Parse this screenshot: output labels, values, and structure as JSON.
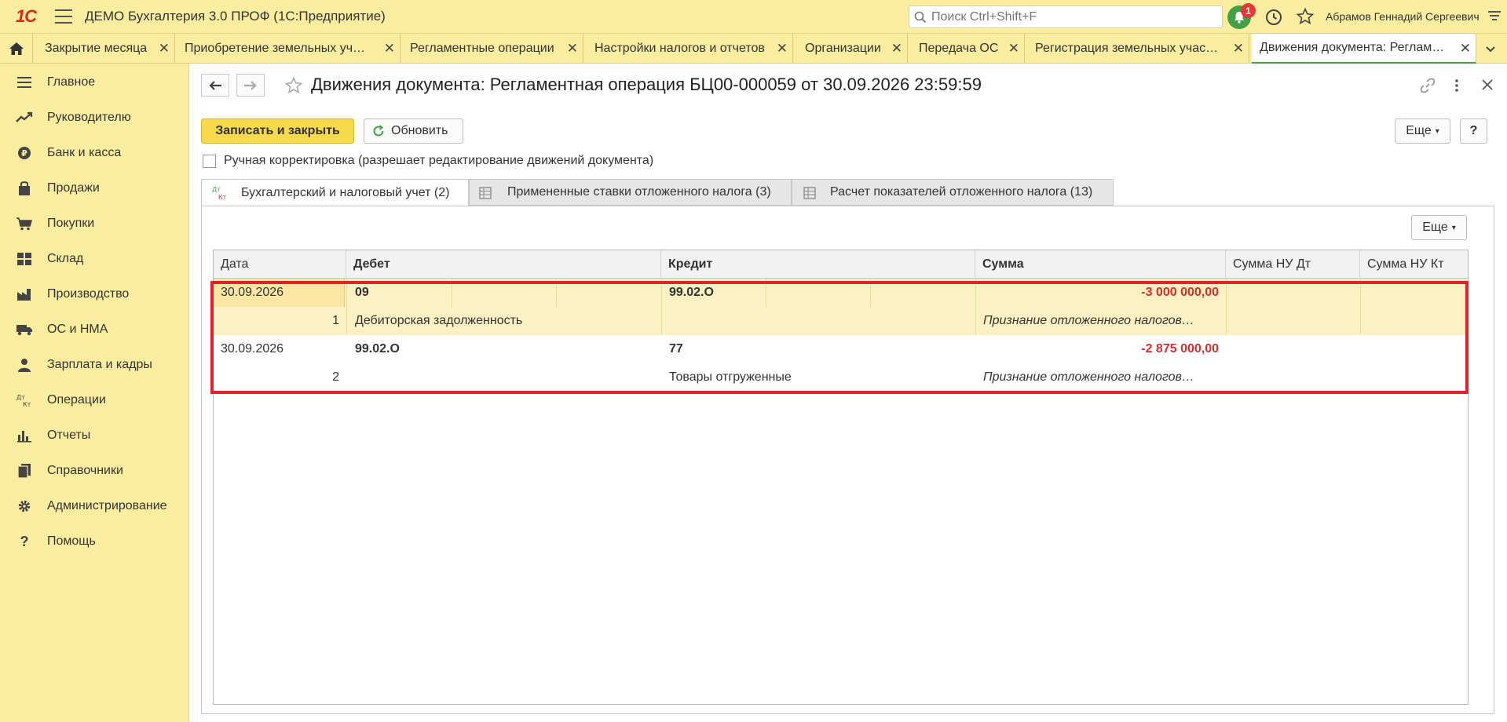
{
  "app": {
    "logo": "1С",
    "title": "ДЕМО Бухгалтерия 3.0 ПРОФ  (1С:Предприятие)",
    "search_placeholder": "Поиск Ctrl+Shift+F",
    "notifications_count": "1",
    "user": "Абрамов Геннадий Сергеевич"
  },
  "tabs": [
    {
      "label": "Закрытие месяца"
    },
    {
      "label": "Приобретение земельных уч…"
    },
    {
      "label": "Регламентные операции"
    },
    {
      "label": "Настройки налогов и отчетов"
    },
    {
      "label": "Организации"
    },
    {
      "label": "Передача ОС"
    },
    {
      "label": "Регистрация земельных учас…"
    },
    {
      "label": "Движения документа: Реглам…"
    }
  ],
  "sidebar": {
    "items": [
      {
        "label": "Главное",
        "icon": "menu-icon"
      },
      {
        "label": "Руководителю",
        "icon": "trend-icon"
      },
      {
        "label": "Банк и касса",
        "icon": "coin-icon"
      },
      {
        "label": "Продажи",
        "icon": "bag-icon"
      },
      {
        "label": "Покупки",
        "icon": "cart-icon"
      },
      {
        "label": "Склад",
        "icon": "warehouse-icon"
      },
      {
        "label": "Производство",
        "icon": "factory-icon"
      },
      {
        "label": "ОС и НМА",
        "icon": "truck-icon"
      },
      {
        "label": "Зарплата и кадры",
        "icon": "person-icon"
      },
      {
        "label": "Операции",
        "icon": "dt-kt-icon"
      },
      {
        "label": "Отчеты",
        "icon": "bar-chart-icon"
      },
      {
        "label": "Справочники",
        "icon": "book-icon"
      },
      {
        "label": "Администрирование",
        "icon": "gear-icon"
      },
      {
        "label": "Помощь",
        "icon": "question-icon"
      }
    ]
  },
  "document": {
    "title": "Движения документа: Регламентная операция БЦ00-000059 от 30.09.2026 23:59:59",
    "save_close_label": "Записать и закрыть",
    "refresh_label": "Обновить",
    "more_label": "Еще",
    "help_label": "?",
    "manual_edit_label": "Ручная корректировка (разрешает редактирование движений документа)"
  },
  "form_tabs": [
    {
      "label": "Бухгалтерский и налоговый учет (2)",
      "icon": "Дт Кт"
    },
    {
      "label": "Примененные ставки отложенного налога (3)"
    },
    {
      "label": "Расчет показателей отложенного налога (13)"
    }
  ],
  "grid": {
    "more_label": "Еще",
    "columns": [
      "Дата",
      "Дебет",
      "Кредит",
      "Сумма",
      "Сумма НУ Дт",
      "Сумма НУ Кт"
    ],
    "rows": [
      {
        "date": "30.09.2026",
        "num": "1",
        "debit": "09",
        "debit_sub": "Дебиторская задолженность",
        "credit": "99.02.О",
        "credit_sub": "",
        "sum": "-3 000 000,00",
        "content": "Признание отложенного налогов…"
      },
      {
        "date": "30.09.2026",
        "num": "2",
        "debit": "99.02.О",
        "debit_sub": "",
        "credit": "77",
        "credit_sub": "Товары отгруженные",
        "sum": "-2 875 000,00",
        "content": "Признание отложенного налогов…"
      }
    ]
  },
  "colors": {
    "accent": "#fbeda0",
    "primary_button": "#f7d94c",
    "highlight_border": "#e3222b",
    "selected_row": "#fdf0c2",
    "negative_sum": "#d32f2f"
  }
}
